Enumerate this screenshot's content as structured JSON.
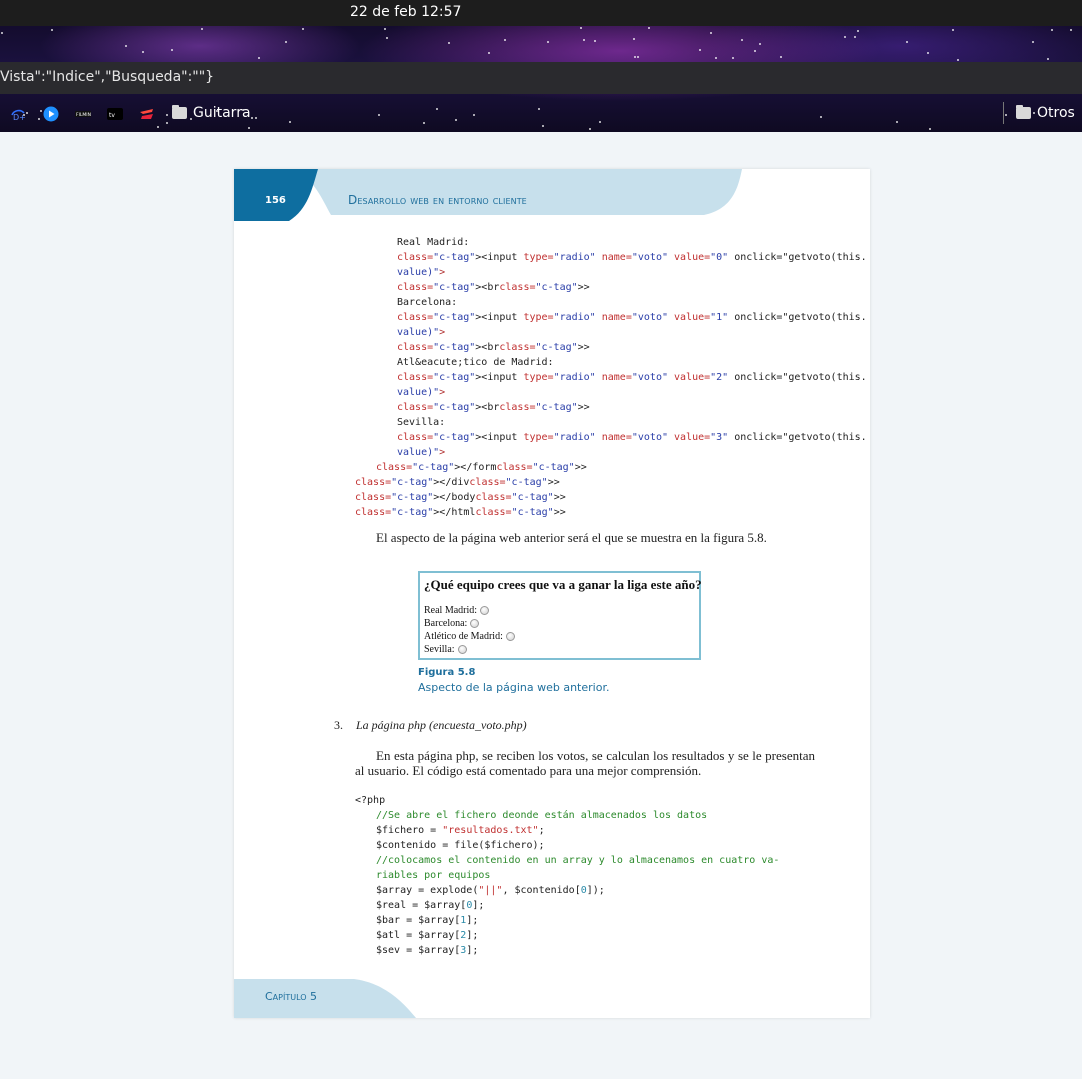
{
  "system": {
    "clock": "22 de feb  12:57"
  },
  "browser": {
    "url": "Vista\":\"Indice\",\"Busqueda\":\"\"}",
    "bookmarks": [
      {
        "icon": "disney-icon"
      },
      {
        "icon": "play-icon"
      },
      {
        "icon": "filmin-icon"
      },
      {
        "icon": "apple-tv-icon"
      },
      {
        "icon": "stadia-icon"
      }
    ],
    "bookmark_folder": "Guitarra",
    "other_folder": "Otros"
  },
  "document": {
    "page_number": "156",
    "running_title": "Desarrollo web en entorno cliente",
    "code1": [
      "Real Madrid:",
      "<input type=\"radio\" name=\"voto\" value=\"0\" onclick=\"getvoto(this.",
      "value)\">",
      "<br>",
      "Barcelona:",
      "<input type=\"radio\" name=\"voto\" value=\"1\" onclick=\"getvoto(this.",
      "value)\">",
      "<br>",
      "Atl&eacute;tico de Madrid:",
      "<input type=\"radio\" name=\"voto\" value=\"2\" onclick=\"getvoto(this.",
      "value)\">",
      "<br>",
      "Sevilla:",
      "<input type=\"radio\" name=\"voto\" value=\"3\" onclick=\"getvoto(this.",
      "value)\">",
      "</form>",
      "</div>",
      "</body>",
      "</html>"
    ],
    "paragraph1": "El aspecto de la página web anterior será el que se muestra en la figura 5.8.",
    "figure": {
      "question": "¿Qué equipo crees que va a ganar la liga este año?",
      "options": [
        "Real Madrid:",
        "Barcelona:",
        "Atlético de Madrid:",
        "Sevilla:"
      ],
      "caption_title": "Figura 5.8",
      "caption_text": "Aspecto de la página web anterior."
    },
    "item3_number": "3.",
    "item3_text": "La página php (encuesta_voto.php)",
    "paragraph2": "En esta página php, se reciben los votos, se calculan los resultados y se le presentan al usuario. El código está comentado para una mejor comprensión.",
    "code2": [
      "<?php",
      "//Se abre el fichero deonde están almacenados los datos",
      "$fichero = \"resultados.txt\";",
      "$contenido = file($fichero);",
      "//colocamos el contenido en un array y lo almacenamos en cuatro va-",
      "riables por equipos",
      "$array = explode(\"||\", $contenido[0]);",
      "$real = $array[0];",
      "$bar = $array[1];",
      "$atl = $array[2];",
      "$sev = $array[3];"
    ],
    "chapter": "Capítulo 5"
  }
}
